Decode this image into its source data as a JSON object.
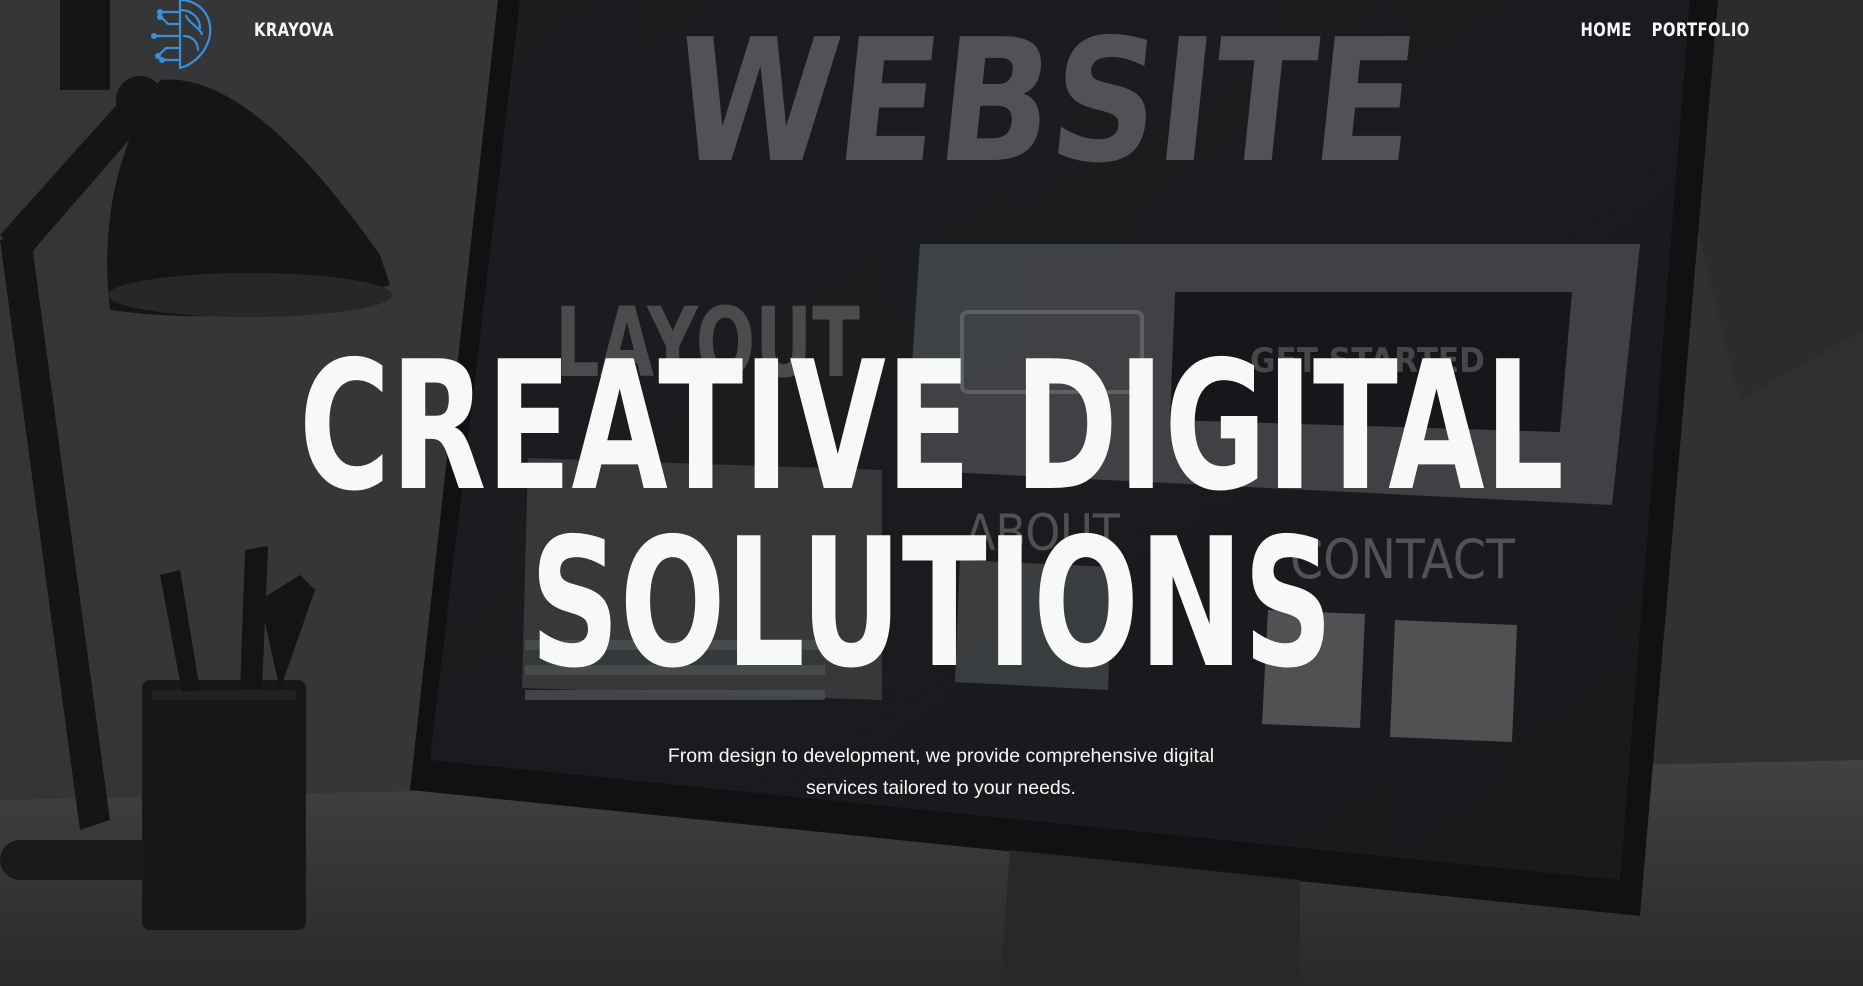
{
  "header": {
    "brand": "KRAYOVA",
    "nav": [
      {
        "label": "HOME"
      },
      {
        "label": "PORTFOLIO"
      }
    ]
  },
  "hero": {
    "headline_line1": "CREATIVE DIGITAL",
    "headline_line2": "SOLUTIONS",
    "subtitle": "From design to development, we provide comprehensive digital services tailored to your needs.",
    "background_text": {
      "monitor_title": "WEBSITE",
      "layout": "LAYOUT",
      "get_started": "GET STARTED",
      "about": "ABOUT",
      "contact": "CONTACT"
    }
  },
  "icons": {
    "logo": "brain-circuit-icon"
  },
  "colors": {
    "text": "#f6f7f6",
    "logo_accent": "#3a8fd9",
    "background": "#3a3b3d"
  }
}
